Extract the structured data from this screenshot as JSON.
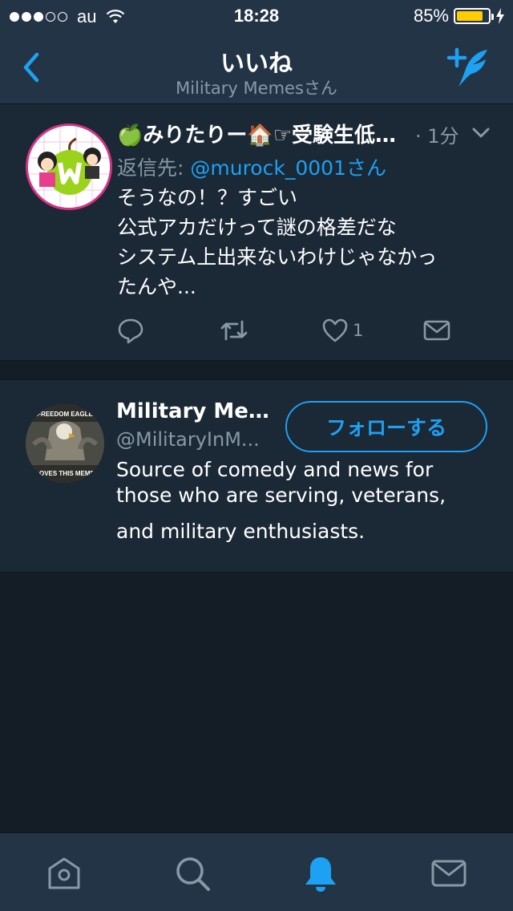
{
  "status_bar": {
    "carrier": "au",
    "time": "18:28",
    "battery_percent": "85%",
    "battery_level": 0.85,
    "signal_bars_filled": 3,
    "signal_bars_total": 5
  },
  "header": {
    "title": "いいね",
    "subtitle": "Military Memesさん"
  },
  "tweet": {
    "author_name": "🍏みりたりー🏠☞受験生低…",
    "time": "· 1分",
    "reply_prefix": "返信先: ",
    "reply_to": "@murock_0001さん",
    "text_lines": [
      "そうなの！？すごい",
      "公式アカだけって謎の格差だな",
      "システム上出来ないわけじゃなかっ",
      "たんや..."
    ],
    "like_count": "1"
  },
  "user_card": {
    "name": "Military Mem...",
    "handle": "@MilitaryInM...",
    "follow_label": "フォローする",
    "bio_lines": [
      "Source of comedy and news for",
      "those who are serving, veterans,",
      "and military enthusiasts."
    ],
    "avatar_text_top": "FREEDOM EAGLE",
    "avatar_text_bottom": "LOVES THIS MEME"
  },
  "tab_bar": {
    "tabs": [
      "home-icon",
      "search-icon",
      "bell-icon",
      "mail-icon"
    ],
    "active": "bell-icon"
  },
  "colors": {
    "accent": "#1da1f2",
    "bg": "#141d26",
    "card": "#1b2836",
    "bar": "#243447",
    "secondary_text": "#8899a6",
    "battery": "#ffcc00"
  }
}
